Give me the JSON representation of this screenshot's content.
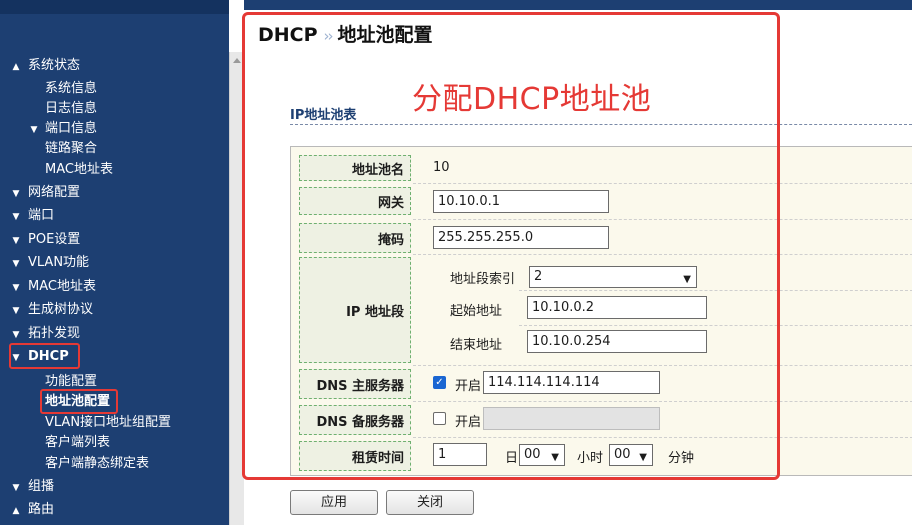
{
  "header": {
    "section": "DHCP",
    "separator": "››",
    "page": "地址池配置"
  },
  "annotation": "分配DHCP地址池",
  "section_title": "IP地址池表",
  "sidebar": {
    "items": [
      {
        "label": "系统状态",
        "arrow": "▲"
      },
      {
        "label": "系统信息"
      },
      {
        "label": "日志信息"
      },
      {
        "label": "端口信息",
        "arrow": "▼"
      },
      {
        "label": "链路聚合"
      },
      {
        "label": "MAC地址表"
      },
      {
        "label": "网络配置",
        "arrow": "▼"
      },
      {
        "label": "端口",
        "arrow": "▼"
      },
      {
        "label": "POE设置",
        "arrow": "▼"
      },
      {
        "label": "VLAN功能",
        "arrow": "▼"
      },
      {
        "label": "MAC地址表",
        "arrow": "▼"
      },
      {
        "label": "生成树协议",
        "arrow": "▼"
      },
      {
        "label": "拓扑发现",
        "arrow": "▼"
      },
      {
        "label": "DHCP",
        "arrow": "▼"
      },
      {
        "label": "功能配置"
      },
      {
        "label": "地址池配置"
      },
      {
        "label": "VLAN接口地址组配置"
      },
      {
        "label": "客户端列表"
      },
      {
        "label": "客户端静态绑定表"
      },
      {
        "label": "组播",
        "arrow": "▼"
      },
      {
        "label": "路由",
        "arrow": "▲"
      }
    ]
  },
  "form": {
    "pool_name": {
      "label": "地址池名",
      "value": "10"
    },
    "gateway": {
      "label": "网关",
      "value": "10.10.0.1"
    },
    "mask": {
      "label": "掩码",
      "value": "255.255.255.0"
    },
    "ip_range": {
      "label": "IP 地址段",
      "index_label": "地址段索引",
      "index_value": "2",
      "start_label": "起始地址",
      "start_value": "10.10.0.2",
      "end_label": "结束地址",
      "end_value": "10.10.0.254"
    },
    "dns_primary": {
      "label": "DNS 主服务器",
      "enable_label": "开启",
      "checked": true,
      "value": "114.114.114.114"
    },
    "dns_secondary": {
      "label": "DNS 备服务器",
      "enable_label": "开启",
      "checked": false,
      "value": ""
    },
    "lease": {
      "label": "租赁时间",
      "days_value": "1",
      "days_unit": "日",
      "hours_value": "00",
      "hours_unit": "小时",
      "minutes_value": "00",
      "minutes_unit": "分钟"
    }
  },
  "buttons": {
    "apply": "应用",
    "close": "关闭"
  },
  "colors": {
    "sidebar_bg": "#1d3f72",
    "highlight": "#e53935",
    "panel_bg": "#fbf9ec",
    "checkbox": "#1a66d2"
  },
  "icons": {
    "expanded": "chevron-up-icon",
    "collapsed": "chevron-down-icon",
    "checked": "checkmark-icon",
    "dropdown": "chevron-down-icon"
  }
}
